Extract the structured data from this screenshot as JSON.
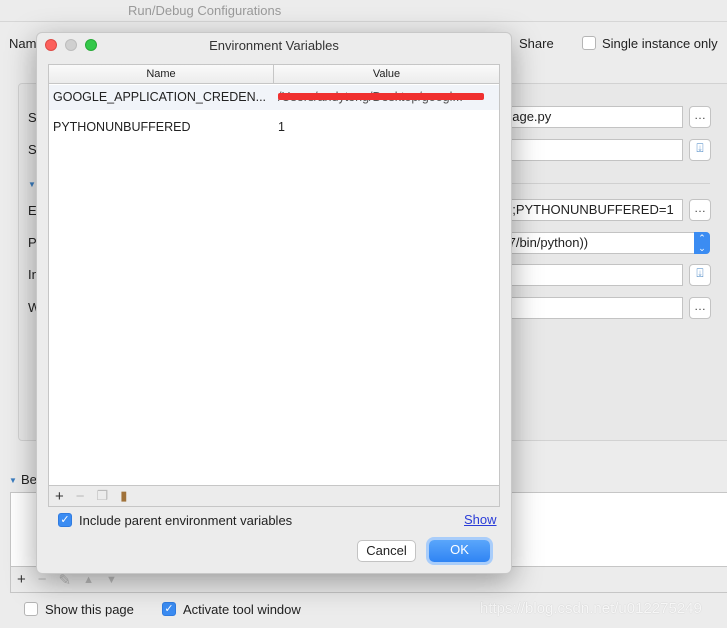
{
  "window": {
    "title": "Run/Debug Configurations"
  },
  "background": {
    "name_label": "Nam",
    "share_label": "Share",
    "single_instance_label": "Single instance only",
    "single_instance_checked": false,
    "field_labels": [
      "S",
      "S",
      "E",
      "P",
      "In",
      "W"
    ],
    "script_value": "nage.py",
    "params_value": "",
    "env_value": "n;PYTHONUNBUFFERED=1",
    "interpreter_value": ".7/bin/python))",
    "interpreter_options_value": "",
    "working_dir_value": "",
    "before_launch_label": "Be",
    "show_this_page_label": "Show this page",
    "show_this_page_checked": false,
    "activate_tool_window_label": "Activate tool window",
    "activate_tool_window_checked": true,
    "watermark": "https://blog.csdn.net/u012275249"
  },
  "dialog": {
    "title": "Environment Variables",
    "columns": [
      "Name",
      "Value"
    ],
    "rows": [
      {
        "name": "GOOGLE_APPLICATION_CREDEN...",
        "value": "/Users/andyteng/Desktop/googl...",
        "redacted": true
      },
      {
        "name": "PYTHONUNBUFFERED",
        "value": "1"
      }
    ],
    "toolbar_icons": [
      "plus-icon",
      "minus-icon",
      "copy-icon",
      "paste-icon"
    ],
    "include_parent_label": "Include parent environment variables",
    "include_parent_checked": true,
    "show_link": "Show",
    "cancel_label": "Cancel",
    "ok_label": "OK"
  },
  "colors": {
    "accent": "#3b8cf2",
    "redaction": "#f03030",
    "link": "#2a3cd8"
  }
}
